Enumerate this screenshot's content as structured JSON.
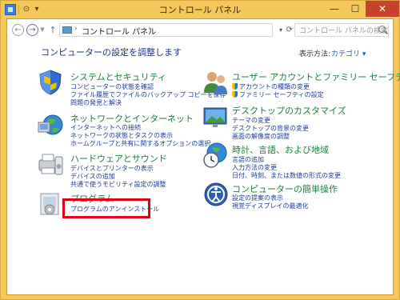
{
  "window": {
    "title": "コントロール パネル",
    "controls": {
      "minimize": "—",
      "maximize": "☐",
      "close": "✕"
    }
  },
  "quick_access": {
    "back": "⊙",
    "down": "▾"
  },
  "address_bar": {
    "back_glyph": "←",
    "forward_glyph": "→",
    "up_glyph": "↑",
    "path": "コントロール パネル",
    "search_placeholder": "コントロール パネルの検索"
  },
  "header": {
    "heading": "コンピューターの設定を調整します",
    "view_by_label": "表示方法:",
    "view_by_value": "カテゴリ ▾"
  },
  "categories": [
    {
      "title": "システムとセキュリティ",
      "tasks": [
        "コンピューターの状態を確認",
        "ファイル履歴でファイルのバックアップ コピーを保存",
        "問題の発見と解決"
      ]
    },
    {
      "title": "ネットワークとインターネット",
      "tasks": [
        "インターネットへの接続",
        "ネットワークの状態とタスクの表示",
        "ホームグループと共有に関するオプションの選択"
      ]
    },
    {
      "title": "ハードウェアとサウンド",
      "tasks": [
        "デバイスとプリンターの表示",
        "デバイスの追加",
        "共通で使うモビリティ設定の調整"
      ]
    },
    {
      "title": "プログラム",
      "tasks": [
        "プログラムのアンインストール"
      ]
    },
    {
      "title": "ユーザー アカウントとファミリー セーフティ",
      "tasks": [
        "アカウントの種類の変更",
        "ファミリー セーフティの設定"
      ]
    },
    {
      "title": "デスクトップのカスタマイズ",
      "tasks": [
        "テーマの変更",
        "デスクトップの背景の変更",
        "画面の解像度の調整"
      ]
    },
    {
      "title": "時計、言語、および地域",
      "tasks": [
        "言語の追加",
        "入力方法の変更",
        "日付、時刻、または数値の形式の変更"
      ]
    },
    {
      "title": "コンピューターの簡単操作",
      "tasks": [
        "設定の提案の表示",
        "視覚ディスプレイの最適化"
      ]
    }
  ]
}
